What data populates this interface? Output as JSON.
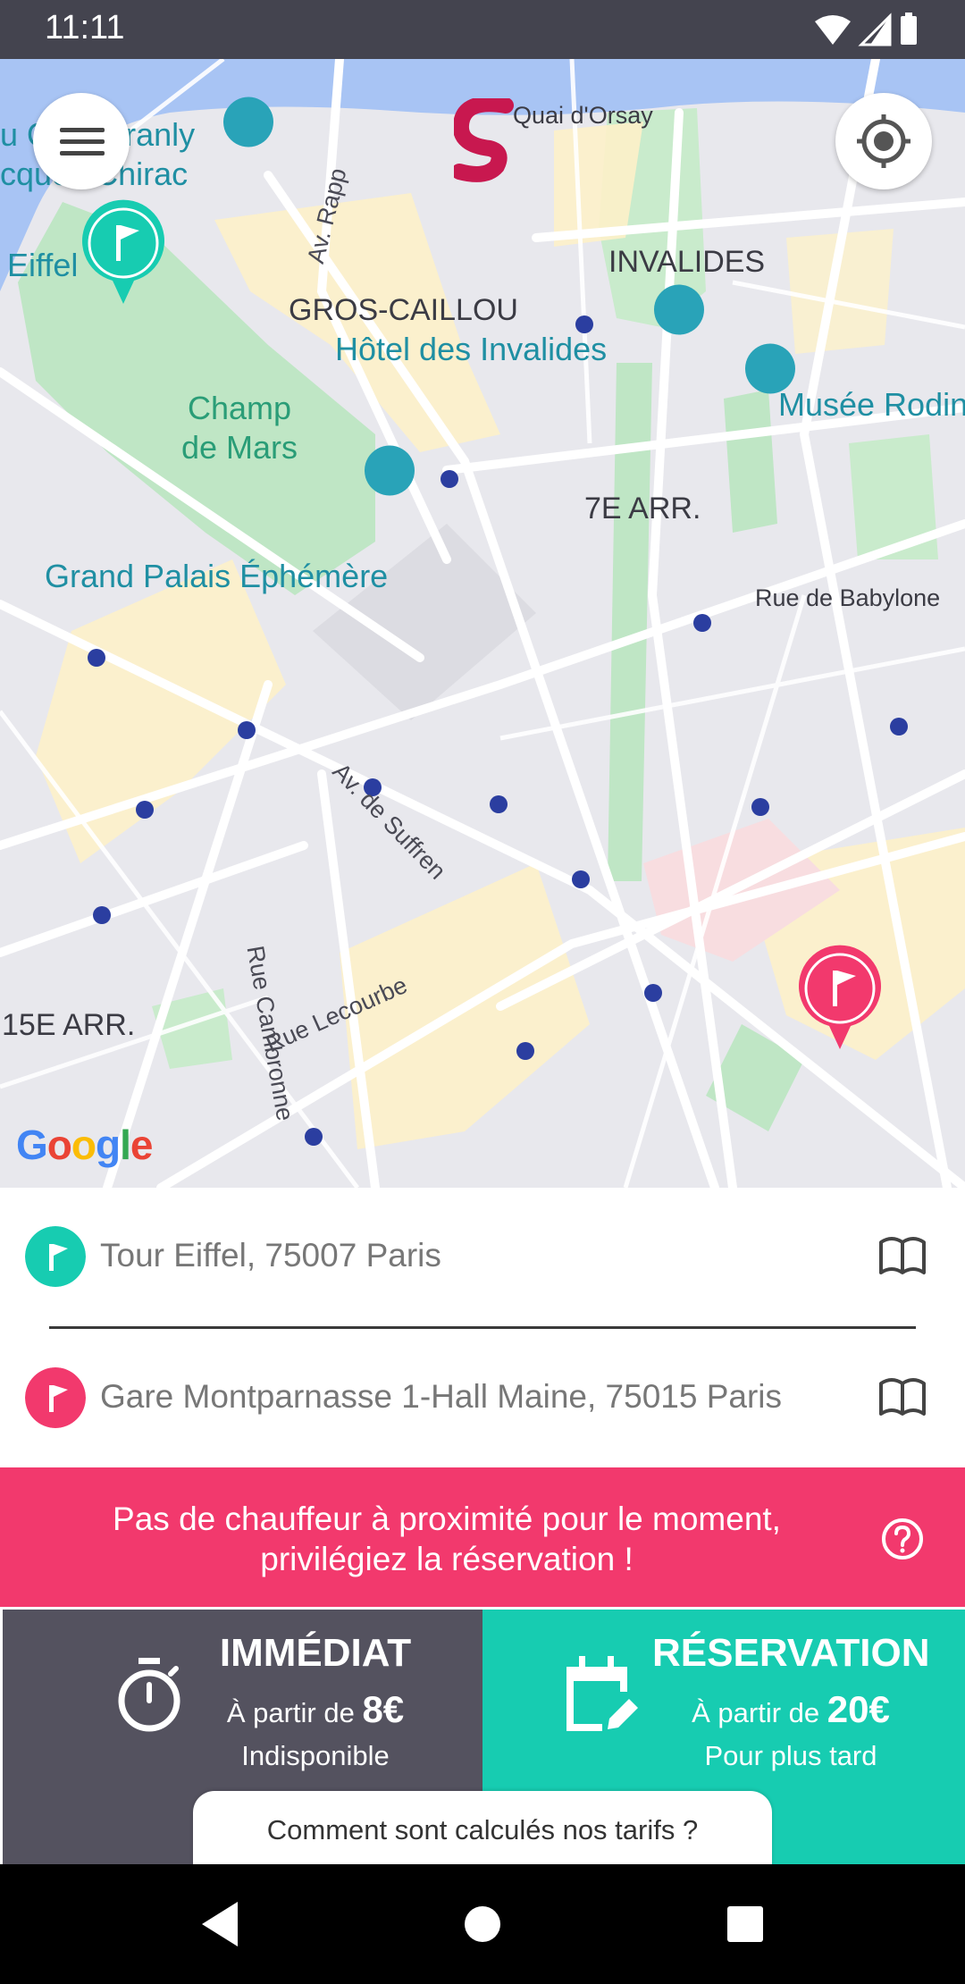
{
  "status_bar": {
    "time": "11:11"
  },
  "map": {
    "labels": {
      "quai_dorsay": "Quai d'Orsay",
      "invalides": "INVALIDES",
      "gros_caillou": "GROS-CAILLOU",
      "hotel_invalides": "Hôtel des Invalides",
      "musee_rodin": "Musée Rodin",
      "champ_de_mars_1": "Champ",
      "champ_de_mars_2": "de Mars",
      "seventh_arr": "7E ARR.",
      "rue_de_babylone": "Rue de Babylone",
      "grand_palais": "Grand Palais Éphémère",
      "av_rapp": "Av. Rapp",
      "av_de_suffren": "Av. de Suffren",
      "rue_cambronne": "Rue Cambronne",
      "rue_lecourbe": "Rue Lecourbe",
      "fifteenth_arr": "15E ARR.",
      "quai_branly_1": "u Quai Branly",
      "quai_branly_2": "cques Chirac",
      "eiffel": "Eiffel"
    },
    "google_logo": "Google"
  },
  "addresses": {
    "departure": {
      "text": "Tour Eiffel, 75007 Paris",
      "color": "#17ccb1"
    },
    "arrival": {
      "text": "Gare Montparnasse 1-Hall Maine, 75015 Paris",
      "color": "#f2396d"
    }
  },
  "alert": {
    "line1": "Pas de chauffeur à proximité pour le moment,",
    "line2": "privilégiez la réservation !"
  },
  "options": {
    "immediate": {
      "title": "IMMÉDIAT",
      "price_prefix": "À partir de",
      "price": "8€",
      "subtitle": "Indisponible"
    },
    "reservation": {
      "title": "RÉSERVATION",
      "price_prefix": "À partir de",
      "price": "20€",
      "subtitle": "Pour plus tard"
    }
  },
  "tariff_link": "Comment sont calculés nos tarifs ?",
  "colors": {
    "accent_teal": "#17ccb1",
    "accent_pink": "#f2396d",
    "dark": "#54525f"
  },
  "icons": [
    "menu-icon",
    "locate-icon",
    "flag-icon",
    "map-book-icon",
    "help-icon",
    "stopwatch-icon",
    "calendar-edit-icon"
  ]
}
